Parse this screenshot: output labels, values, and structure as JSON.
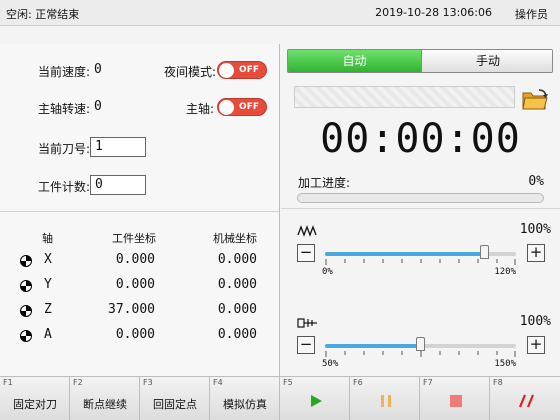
{
  "topbar": {
    "status": "空闲: 正常结束",
    "datetime": "2019-10-28 13:06:06",
    "operator": "操作员"
  },
  "left": {
    "speed_label": "当前速度:",
    "speed_value": "0",
    "spindle_label": "主轴转速:",
    "spindle_value": "0",
    "tool_label": "当前刀号:",
    "tool_value": "1",
    "count_label": "工件计数:",
    "count_value": "0",
    "night_label": "夜间模式:",
    "night_toggle": "OFF",
    "spindle_switch_label": "主轴:",
    "spindle_toggle": "OFF"
  },
  "axes": {
    "headers": {
      "axis": "轴",
      "work": "工件坐标",
      "machine": "机械坐标"
    },
    "rows": [
      {
        "name": "X",
        "work": "0.000",
        "machine": "0.000"
      },
      {
        "name": "Y",
        "work": "0.000",
        "machine": "0.000"
      },
      {
        "name": "Z",
        "work": "37.000",
        "machine": "0.000"
      },
      {
        "name": "A",
        "work": "0.000",
        "machine": "0.000"
      }
    ]
  },
  "right": {
    "mode_auto": "自动",
    "mode_manual": "手动",
    "active_mode": "auto",
    "timer": "00:00:00",
    "progress_label": "加工进度:",
    "progress_value": "0%",
    "progress_fraction": 0.0,
    "feed": {
      "percent": "100%",
      "min": "0%",
      "max": "120%",
      "level": 100,
      "range": [
        0,
        120
      ],
      "minus": "−",
      "plus": "+",
      "icon": "feedrate-icon"
    },
    "spindle_override": {
      "percent": "100%",
      "min": "50%",
      "max": "150%",
      "level": 100,
      "range": [
        50,
        150
      ],
      "minus": "−",
      "plus": "+",
      "icon": "spindle-icon"
    }
  },
  "fkeys": [
    {
      "fn": "F1",
      "label": "固定对刀"
    },
    {
      "fn": "F2",
      "label": "断点继续"
    },
    {
      "fn": "F3",
      "label": "回固定点"
    },
    {
      "fn": "F4",
      "label": "模拟仿真"
    },
    {
      "fn": "F5",
      "label": "",
      "icon": "play-icon"
    },
    {
      "fn": "F6",
      "label": "",
      "icon": "pause-icon"
    },
    {
      "fn": "F7",
      "label": "",
      "icon": "stop-icon"
    },
    {
      "fn": "F8",
      "label": "",
      "icon": "emergency-icon"
    }
  ],
  "colors": {
    "accent_green": "#2fb42f",
    "toggle_red": "#e64b3b",
    "slider_blue": "#49a7e1",
    "play_green": "#22aa22",
    "pause_orange": "#f0b25a",
    "stop_red": "#f07a7a",
    "emergency_red": "#e02020"
  }
}
